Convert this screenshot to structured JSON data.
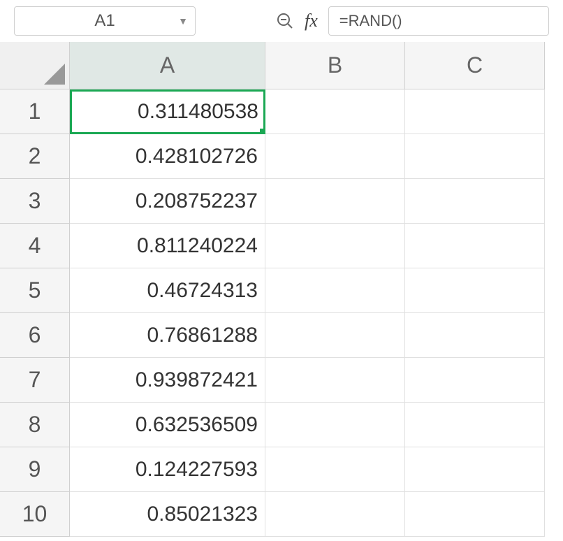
{
  "namebox": {
    "value": "A1"
  },
  "formula": {
    "value": "=RAND()"
  },
  "fx_label": "fx",
  "columns": [
    "A",
    "B",
    "C"
  ],
  "rows": [
    {
      "num": "1",
      "cells": [
        "0.311480538",
        "",
        ""
      ]
    },
    {
      "num": "2",
      "cells": [
        "0.428102726",
        "",
        ""
      ]
    },
    {
      "num": "3",
      "cells": [
        "0.208752237",
        "",
        ""
      ]
    },
    {
      "num": "4",
      "cells": [
        "0.811240224",
        "",
        ""
      ]
    },
    {
      "num": "5",
      "cells": [
        "0.46724313",
        "",
        ""
      ]
    },
    {
      "num": "6",
      "cells": [
        "0.76861288",
        "",
        ""
      ]
    },
    {
      "num": "7",
      "cells": [
        "0.939872421",
        "",
        ""
      ]
    },
    {
      "num": "8",
      "cells": [
        "0.632536509",
        "",
        ""
      ]
    },
    {
      "num": "9",
      "cells": [
        "0.124227593",
        "",
        ""
      ]
    },
    {
      "num": "10",
      "cells": [
        "0.85021323",
        "",
        ""
      ]
    }
  ],
  "selected_cell": {
    "row": 0,
    "col": 0
  },
  "selected_col": 0
}
